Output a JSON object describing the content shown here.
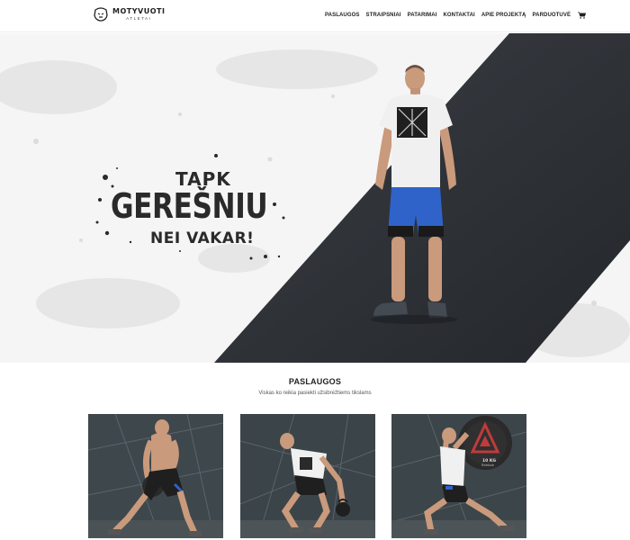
{
  "header": {
    "logo_name": "MOTYVUOTI",
    "logo_sub": "ATLETAI",
    "nav": [
      "PASLAUGOS",
      "STRAIPSNIAI",
      "PATARIMAI",
      "KONTAKTAI",
      "APIE PROJEKTĄ",
      "PARDUOTUVĖ"
    ]
  },
  "hero": {
    "slogan_line1": "TAPK",
    "slogan_line2": "GEREŠNIU",
    "slogan_line3": "NEI VAKAR!"
  },
  "services": {
    "title": "PASLAUGOS",
    "subtitle": "Viskas ko reikia pasiekti užsibrėžtiems tikslams",
    "cards": [
      {
        "name": "medicine-ball-workout"
      },
      {
        "name": "kettlebell-workout"
      },
      {
        "name": "weight-plate-lunge",
        "plate_brand": "10 KG",
        "plate_maker": "Reebok"
      }
    ]
  },
  "colors": {
    "hero_dark": "#2d3035",
    "card_bg": "#3b4347",
    "text": "#222222",
    "shorts_blue": "#2f63c9"
  },
  "icons": [
    "skull-logo-icon",
    "cart-icon"
  ]
}
